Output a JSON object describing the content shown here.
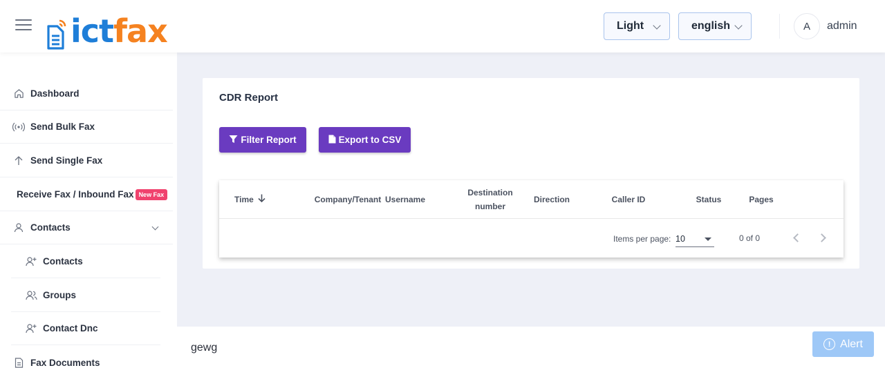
{
  "header": {
    "logo": {
      "part1": "ict",
      "part2": "fax"
    },
    "theme_select": "Light",
    "language_select": "english",
    "avatar_initial": "A",
    "username": "admin"
  },
  "sidebar": {
    "items": [
      {
        "label": "Dashboard",
        "icon": "home-icon"
      },
      {
        "label": "Send Bulk Fax",
        "icon": "broadcast-icon"
      },
      {
        "label": "Send Single Fax",
        "icon": "arrow-up-icon"
      },
      {
        "label": "Receive Fax / Inbound Fax",
        "badge": "New Fax"
      },
      {
        "label": "Contacts",
        "icon": "user-icon",
        "expanded": true,
        "children": [
          {
            "label": "Contacts",
            "icon": "user-plus-icon"
          },
          {
            "label": "Groups",
            "icon": "users-icon"
          },
          {
            "label": "Contact Dnc",
            "icon": "user-plus-icon"
          }
        ]
      },
      {
        "label": "Fax Documents",
        "icon": "document-icon"
      }
    ]
  },
  "report": {
    "title": "CDR Report",
    "filter_button": "Filter Report",
    "export_button": "Export to CSV",
    "columns": [
      "Time",
      "Company/Tenant",
      "Username",
      "Destination number",
      "Direction",
      "Caller ID",
      "Status",
      "Pages"
    ],
    "rows": [],
    "paginator": {
      "items_per_page_label": "Items per page:",
      "items_per_page": "10",
      "range": "0 of 0"
    }
  },
  "footer": {
    "text": "gewg"
  },
  "alert_button": "Alert",
  "colors": {
    "primary_button": "#6a3bc0",
    "logo_blue": "#1e7ed8",
    "logo_orange": "#f58220",
    "badge": "#f0426e",
    "alert": "#9ec8f7"
  }
}
